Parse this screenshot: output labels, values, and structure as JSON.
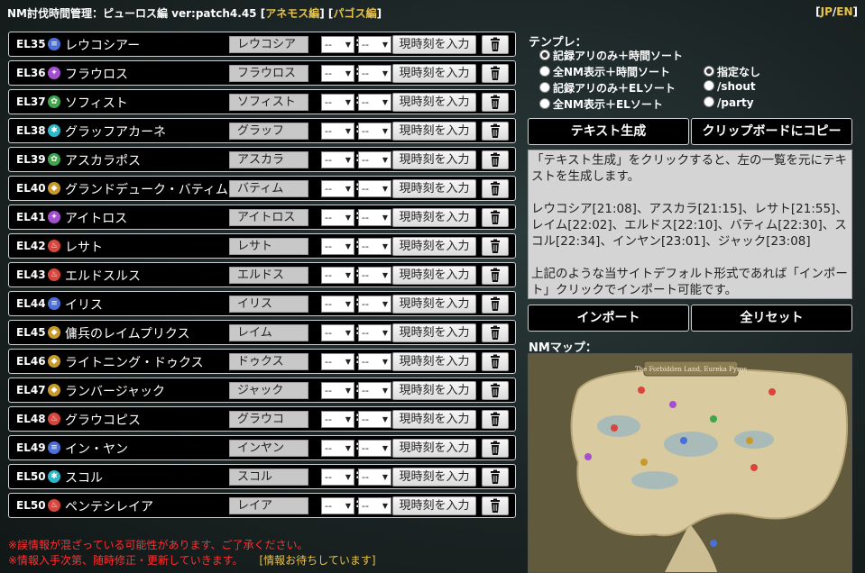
{
  "header": {
    "title": "NM討伐時間管理：ピューロス編 ver:patch4.45",
    "link1": "アネモス編",
    "link2": "パゴス編",
    "lang_jp": "JP",
    "lang_sep": "/",
    "lang_en": "EN"
  },
  "rows": [
    {
      "el": "EL35",
      "name": "レウコシアー",
      "short": "レウコシア",
      "element": "water"
    },
    {
      "el": "EL36",
      "name": "フラウロス",
      "short": "フラウロス",
      "element": "lightning"
    },
    {
      "el": "EL37",
      "name": "ソフィスト",
      "short": "ソフィスト",
      "element": "wind"
    },
    {
      "el": "EL38",
      "name": "グラッフアカーネ",
      "short": "グラッフ",
      "element": "ice"
    },
    {
      "el": "EL39",
      "name": "アスカラポス",
      "short": "アスカラ",
      "element": "wind"
    },
    {
      "el": "EL40",
      "name": "グランドデューク・バティム",
      "short": "バティム",
      "element": "earth"
    },
    {
      "el": "EL41",
      "name": "アイトロス",
      "short": "アイトロス",
      "element": "lightning"
    },
    {
      "el": "EL42",
      "name": "レサト",
      "short": "レサト",
      "element": "fire"
    },
    {
      "el": "EL43",
      "name": "エルドスルス",
      "short": "エルドス",
      "element": "fire"
    },
    {
      "el": "EL44",
      "name": "イリス",
      "short": "イリス",
      "element": "water"
    },
    {
      "el": "EL45",
      "name": "傭兵のレイムプリクス",
      "short": "レイム",
      "element": "earth"
    },
    {
      "el": "EL46",
      "name": "ライトニング・ドゥクス",
      "short": "ドゥクス",
      "element": "earth"
    },
    {
      "el": "EL47",
      "name": "ランバージャック",
      "short": "ジャック",
      "element": "earth"
    },
    {
      "el": "EL48",
      "name": "グラウコピス",
      "short": "グラウコ",
      "element": "fire"
    },
    {
      "el": "EL49",
      "name": "イン・ヤン",
      "short": "インヤン",
      "element": "water"
    },
    {
      "el": "EL50",
      "name": "スコル",
      "short": "スコル",
      "element": "ice"
    },
    {
      "el": "EL50",
      "name": "ペンテシレイア",
      "short": "レイア",
      "element": "fire"
    }
  ],
  "row_ui": {
    "hour_value": "--",
    "minute_value": "--",
    "separator": ":",
    "now_button": "現時刻を入力"
  },
  "element_colors": {
    "water": "#4a6fd8",
    "lightning": "#a44fd0",
    "wind": "#3fa54a",
    "ice": "#2bb8c8",
    "earth": "#c89a2a",
    "fire": "#d8453a"
  },
  "notes": {
    "line1": "※誤情報が混ざっている可能性があります、ご了承ください。",
    "line2": "※情報入手次第、随時修正・更新していきます。",
    "wait": "[情報お待ちしています]"
  },
  "template": {
    "label": "テンプレ：",
    "options": [
      {
        "label": "記録アリのみ＋時間ソート",
        "checked": true
      },
      {
        "label": "全NM表示＋時間ソート",
        "checked": false
      },
      {
        "label": "記録アリのみ＋ELソート",
        "checked": false
      },
      {
        "label": "全NM表示＋ELソート",
        "checked": false
      }
    ],
    "chat": [
      {
        "label": "指定なし",
        "checked": true
      },
      {
        "label": "/shout",
        "checked": false
      },
      {
        "label": "/party",
        "checked": false
      }
    ]
  },
  "buttons": {
    "generate": "テキスト生成",
    "copy": "クリップボードにコピー",
    "import": "インポート",
    "reset": "全リセット"
  },
  "textarea": {
    "p1": "「テキスト生成」をクリックすると、左の一覧を元にテキストを生成します。",
    "p2": "レウコシア[21:08]、アスカラ[21:15]、レサト[21:55]、レイム[22:02]、エルドス[22:10]、バティム[22:30]、スコル[22:34]、インヤン[23:01]、ジャック[23:08]",
    "p3": "上記のような当サイトデフォルト形式であれば「インポート」クリックでインポート可能です。"
  },
  "map": {
    "label": "NMマップ：",
    "title": "The Forbidden Land, Eureka Pyros"
  }
}
